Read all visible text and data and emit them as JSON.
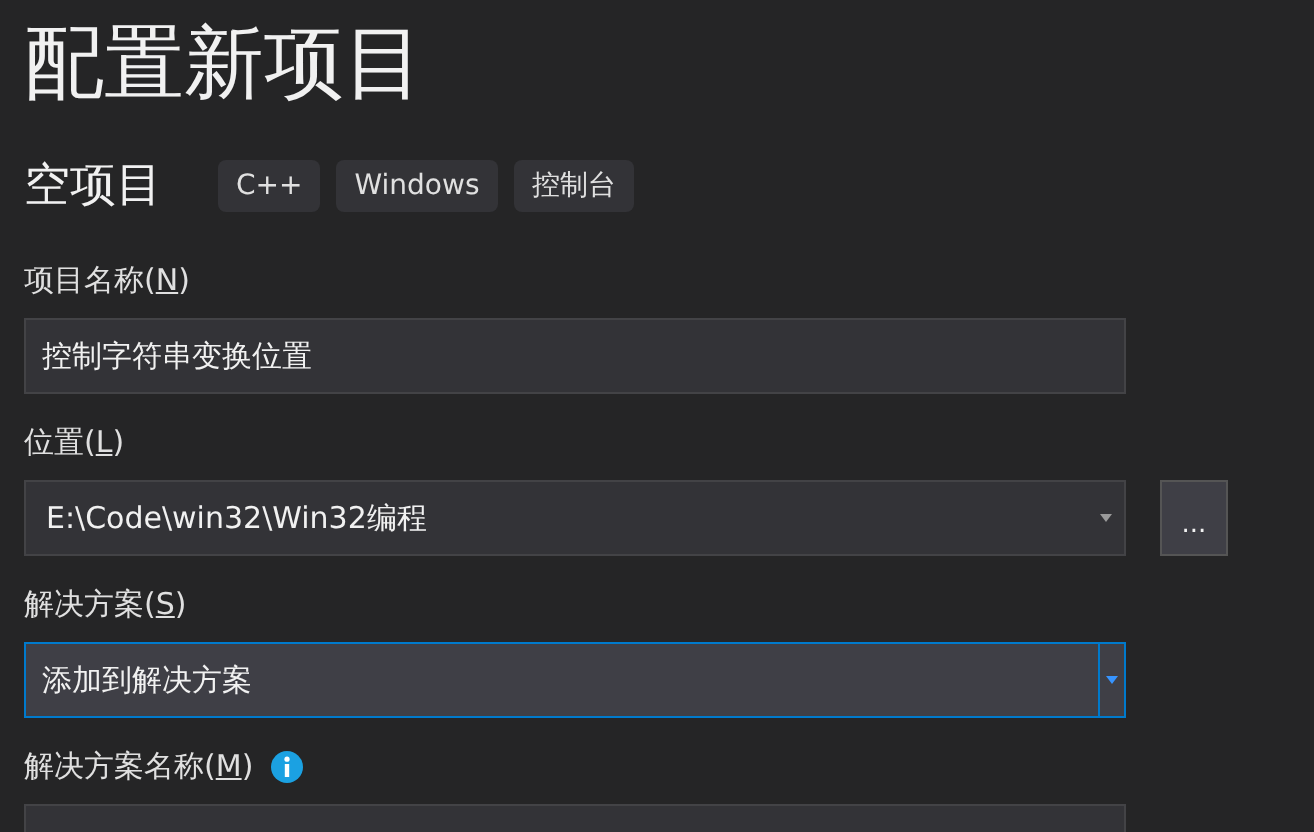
{
  "title": "配置新项目",
  "template": {
    "name": "空项目",
    "tags": [
      "C++",
      "Windows",
      "控制台"
    ]
  },
  "fields": [
    {
      "kind": "text",
      "label_before": "项目名称(",
      "access_key": "N",
      "label_after": ")",
      "value": "控制字符串变换位置",
      "focused": false
    },
    {
      "kind": "combo-browse",
      "label_before": "位置(",
      "access_key": "L",
      "label_after": ")",
      "value": "E:\\Code\\win32\\Win32编程",
      "browse": "...",
      "focused": false
    },
    {
      "kind": "combo",
      "label_before": "解决方案(",
      "access_key": "S",
      "label_after": ")",
      "value": "添加到解决方案",
      "focused": true
    },
    {
      "kind": "text-info",
      "label_before": "解决方案名称(",
      "access_key": "M",
      "label_after": ")",
      "focused": false
    }
  ]
}
